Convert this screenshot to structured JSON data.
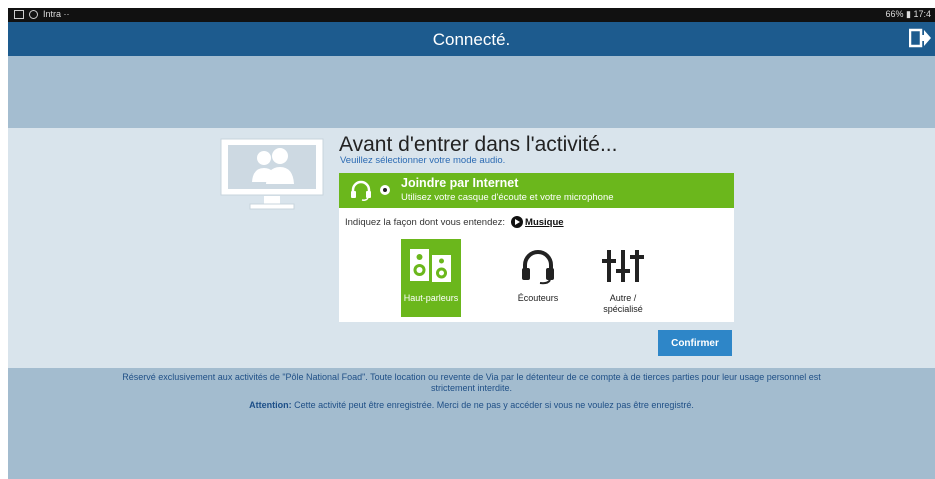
{
  "status_bar": {
    "left_text": "Intra ··",
    "right_text": "66% ▮ 17:4"
  },
  "header": {
    "title": "Connecté.",
    "exit_icon": "exit-icon"
  },
  "dialog": {
    "heading": "Avant d'entrer dans l'activité...",
    "subheading": "Veuillez sélectionner votre mode audio.",
    "internet_option": {
      "title": "Joindre par Internet",
      "subtitle": "Utilisez votre casque d'écoute et votre microphone",
      "selected": true,
      "icon": "headset-icon"
    },
    "prompt": "Indiquez la façon dont vous entendez:",
    "music_link": "Musique",
    "outputs": [
      {
        "label": "Haut-parleurs",
        "icon": "speakers-icon",
        "selected": true
      },
      {
        "label": "Écouteurs",
        "icon": "headphones-icon",
        "selected": false
      },
      {
        "label_line1": "Autre /",
        "label_line2": "spécialisé",
        "icon": "sliders-icon",
        "selected": false
      }
    ],
    "confirm_label": "Confirmer"
  },
  "footer": {
    "notice_line1": "Réservé exclusivement aux activités de \"Pôle National Foad\". Toute location ou revente de Via par le détenteur de ce compte à de tierces parties pour leur usage personnel est",
    "notice_line2": "strictement interdite.",
    "attention_label": "Attention:",
    "attention_text": "Cette activité peut être enregistrée. Merci de ne pas y accéder si vous ne voulez pas être enregistré."
  },
  "colors": {
    "header_blue": "#1d5b8e",
    "accent_green": "#6bb71c",
    "confirm_blue": "#2e86c8",
    "background_blue": "#a3bccf"
  }
}
